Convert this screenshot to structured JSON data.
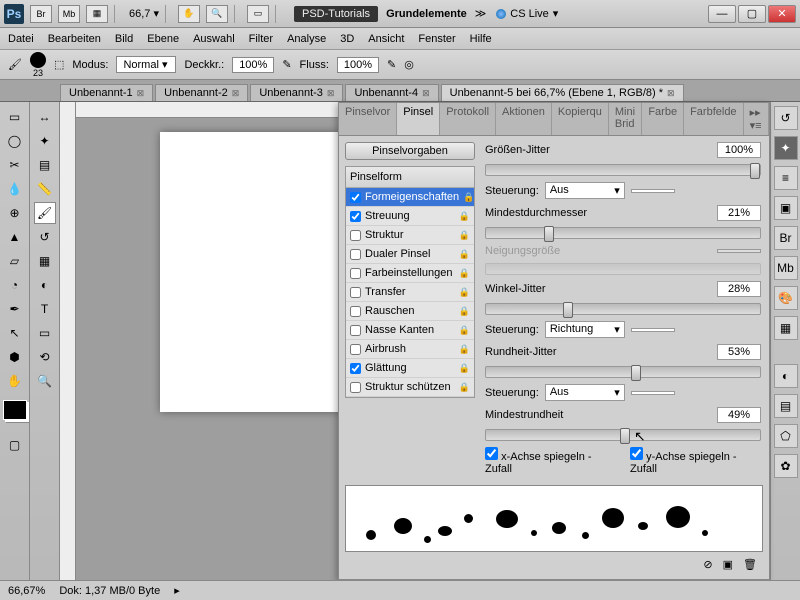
{
  "titlebar": {
    "zoom": "66,7",
    "psd": "PSD-Tutorials",
    "grund": "Grundelemente",
    "cs": "CS Live"
  },
  "menu": [
    "Datei",
    "Bearbeiten",
    "Bild",
    "Ebene",
    "Auswahl",
    "Filter",
    "Analyse",
    "3D",
    "Ansicht",
    "Fenster",
    "Hilfe"
  ],
  "opt": {
    "size": "23",
    "modus_l": "Modus:",
    "modus": "Normal",
    "deck_l": "Deckkr.:",
    "deck": "100%",
    "fluss_l": "Fluss:",
    "fluss": "100%"
  },
  "tabs": [
    "Unbenannt-1",
    "Unbenannt-2",
    "Unbenannt-3",
    "Unbenannt-4"
  ],
  "tab_active": "Unbenannt-5 bei 66,7% (Ebene 1, RGB/8) *",
  "status": {
    "zoom": "66,67%",
    "dok": "Dok: 1,37 MB/0 Byte"
  },
  "bp_tabs": [
    "Pinselvor",
    "Pinsel",
    "Protokoll",
    "Aktionen",
    "Kopierqu",
    "Mini Brid",
    "Farbe",
    "Farbfelde"
  ],
  "bp_btn": "Pinselvorgaben",
  "bp_head": "Pinselform",
  "bp_items": [
    {
      "l": "Formeigenschaften",
      "c": true,
      "sel": true
    },
    {
      "l": "Streuung",
      "c": true
    },
    {
      "l": "Struktur",
      "c": false
    },
    {
      "l": "Dualer Pinsel",
      "c": false
    },
    {
      "l": "Farbeinstellungen",
      "c": false
    },
    {
      "l": "Transfer",
      "c": false
    },
    {
      "l": "Rauschen",
      "c": false
    },
    {
      "l": "Nasse Kanten",
      "c": false
    },
    {
      "l": "Airbrush",
      "c": false
    },
    {
      "l": "Glättung",
      "c": true
    },
    {
      "l": "Struktur schützen",
      "c": false
    }
  ],
  "r": {
    "groessen": "Größen-Jitter",
    "gv": "100%",
    "st": "Steuerung:",
    "aus": "Aus",
    "mind": "Mindestdurchmesser",
    "mv": "21%",
    "neig": "Neigungsgröße",
    "winkel": "Winkel-Jitter",
    "wv": "28%",
    "richt": "Richtung",
    "rund": "Rundheit-Jitter",
    "rv": "53%",
    "mindr": "Mindestrundheit",
    "mrv": "49%",
    "xa": "x-Achse spiegeln - Zufall",
    "ya": "y-Achse spiegeln - Zufall"
  }
}
